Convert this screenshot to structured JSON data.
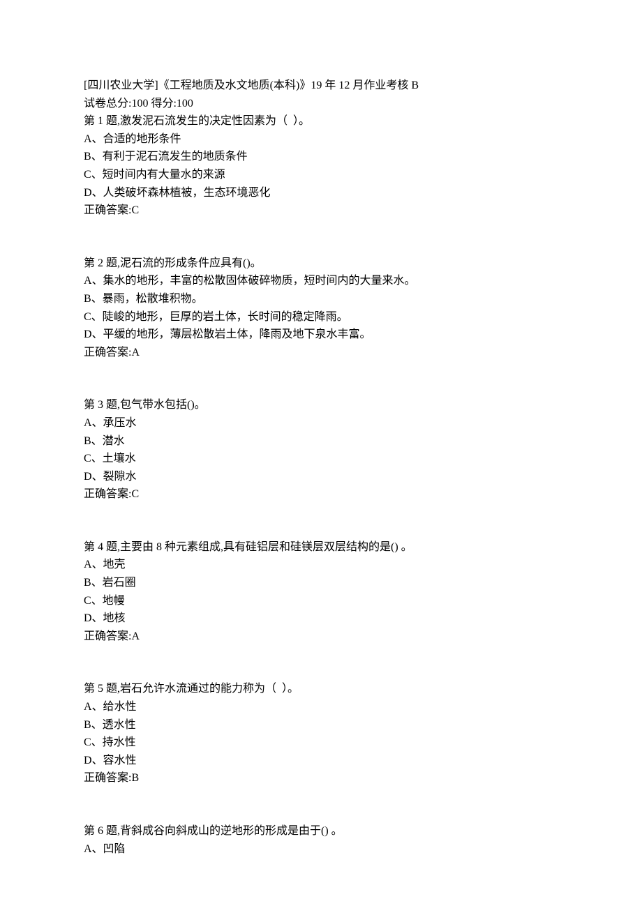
{
  "header": {
    "title": "[四川农业大学]《工程地质及水文地质(本科)》19 年 12 月作业考核 B",
    "score_line": "试卷总分:100     得分:100"
  },
  "questions": [
    {
      "stem": "第 1 题,激发泥石流发生的决定性因素为（  ）。",
      "options": [
        "A、合适的地形条件",
        "B、有利于泥石流发生的地质条件",
        "C、短时间内有大量水的来源",
        "D、人类破坏森林植被，生态环境恶化"
      ],
      "answer": "正确答案:C"
    },
    {
      "stem": "第 2 题,泥石流的形成条件应具有()。",
      "options": [
        "A、集水的地形，丰富的松散固体破碎物质，短时间内的大量来水。",
        "B、暴雨，松散堆积物。",
        "C、陡峻的地形，巨厚的岩土体，长时间的稳定降雨。",
        "D、平缓的地形，薄层松散岩土体，降雨及地下泉水丰富。"
      ],
      "answer": "正确答案:A"
    },
    {
      "stem": "第 3 题,包气带水包括()。",
      "options": [
        "A、承压水",
        "B、潜水",
        "C、土壤水",
        "D、裂隙水"
      ],
      "answer": "正确答案:C"
    },
    {
      "stem": "第 4 题,主要由 8 种元素组成,具有硅铝层和硅镁层双层结构的是() 。",
      "options": [
        "A、地壳",
        "B、岩石圈",
        "C、地幔",
        "D、地核"
      ],
      "answer": "正确答案:A"
    },
    {
      "stem": "第 5 题,岩石允许水流通过的能力称为（  ）。",
      "options": [
        "A、给水性",
        "B、透水性",
        "C、持水性",
        "D、容水性"
      ],
      "answer": "正确答案:B"
    },
    {
      "stem": "第 6 题,背斜成谷向斜成山的逆地形的形成是由于() 。",
      "options": [
        "A、凹陷"
      ],
      "answer": ""
    }
  ]
}
